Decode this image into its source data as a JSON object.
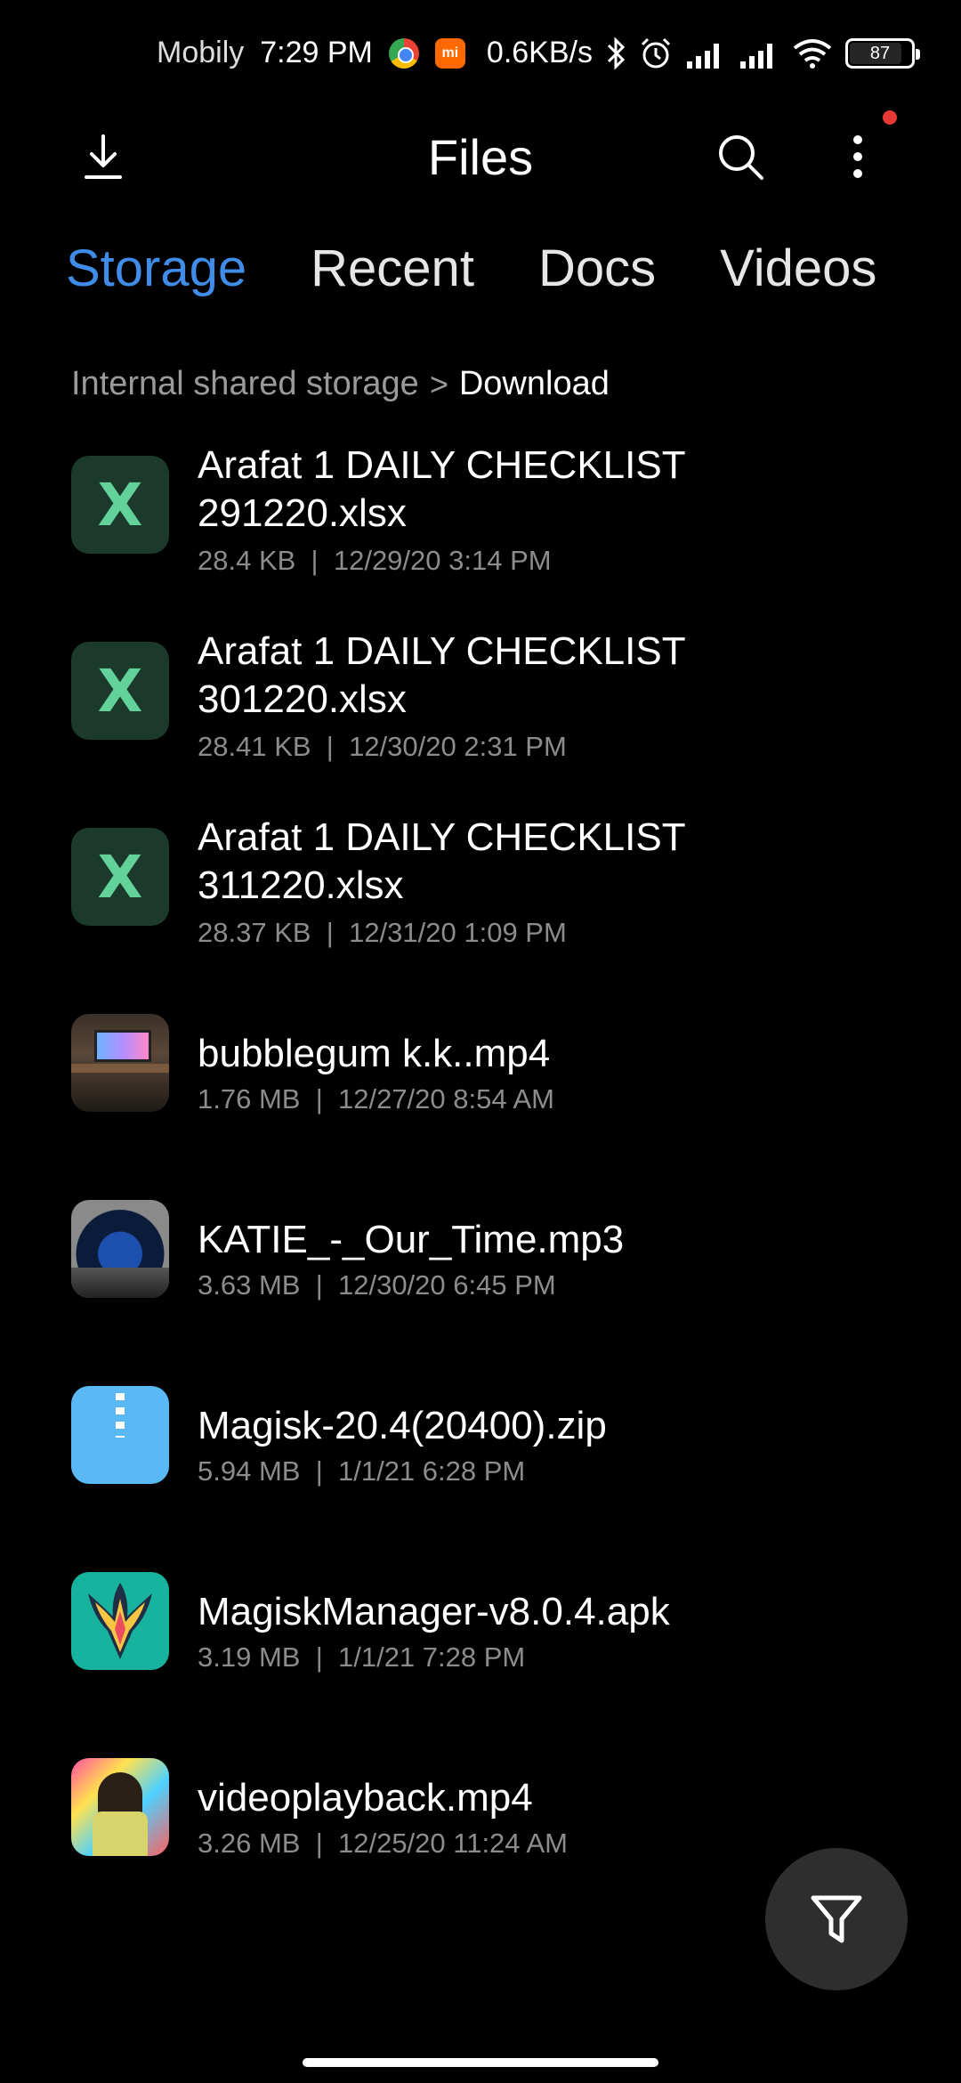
{
  "status_bar": {
    "carrier": "Mobily",
    "time": "7:29 PM",
    "network_speed": "0.6KB/s",
    "battery": "87",
    "icons": [
      "chrome-icon",
      "mi-icon",
      "bluetooth-icon",
      "alarm-icon",
      "signal-icon",
      "signal-icon-2",
      "wifi-icon",
      "battery-icon"
    ]
  },
  "header": {
    "title": "Files",
    "icons": [
      "download-icon",
      "search-icon",
      "more-vert-icon"
    ]
  },
  "tabs": [
    {
      "label": "Storage",
      "active": true
    },
    {
      "label": "Recent",
      "active": false
    },
    {
      "label": "Docs",
      "active": false
    },
    {
      "label": "Videos",
      "active": false
    }
  ],
  "breadcrumb": {
    "root": "Internal shared storage",
    "separator": ">",
    "current": "Download"
  },
  "files": [
    {
      "name_line1": "Arafat 1 DAILY CHECKLIST",
      "name_line2": "291220.xlsx",
      "size": "28.4 KB",
      "date": "12/29/20 3:14 PM",
      "type": "xlsx",
      "icon": "excel-icon"
    },
    {
      "name_line1": "Arafat 1 DAILY CHECKLIST",
      "name_line2": "301220.xlsx",
      "size": "28.41 KB",
      "date": "12/30/20 2:31 PM",
      "type": "xlsx",
      "icon": "excel-icon"
    },
    {
      "name_line1": "Arafat 1 DAILY CHECKLIST",
      "name_line2": "311220.xlsx",
      "size": "28.37 KB",
      "date": "12/31/20 1:09 PM",
      "type": "xlsx",
      "icon": "excel-icon"
    },
    {
      "name_line1": "bubblegum k.k..mp4",
      "name_line2": "",
      "size": "1.76 MB",
      "date": "12/27/20 8:54 AM",
      "type": "mp4",
      "icon": "video-thumbnail"
    },
    {
      "name_line1": "KATIE_-_Our_Time.mp3",
      "name_line2": "",
      "size": "3.63 MB",
      "date": "12/30/20 6:45 PM",
      "type": "mp3",
      "icon": "audio-thumbnail"
    },
    {
      "name_line1": "Magisk-20.4(20400).zip",
      "name_line2": "",
      "size": "5.94 MB",
      "date": "1/1/21 6:28 PM",
      "type": "zip",
      "icon": "zip-icon"
    },
    {
      "name_line1": "MagiskManager-v8.0.4.apk",
      "name_line2": "",
      "size": "3.19 MB",
      "date": "1/1/21 7:28 PM",
      "type": "apk",
      "icon": "magisk-icon"
    },
    {
      "name_line1": "videoplayback.mp4",
      "name_line2": "",
      "size": "3.26 MB",
      "date": "12/25/20 11:24 AM",
      "type": "mp4",
      "icon": "video-thumbnail"
    }
  ],
  "meta_separator": "|",
  "fab": {
    "icon": "filter-icon"
  },
  "colors": {
    "background": "#000000",
    "accent": "#3f8de8",
    "meta_text": "#8c8c8c",
    "xlsx_tile": "#1c3a2b",
    "xlsx_glyph": "#63d29a",
    "zip_tile": "#5ab8f5",
    "apk_tile": "#18b39e",
    "notification_dot": "#e53935"
  }
}
